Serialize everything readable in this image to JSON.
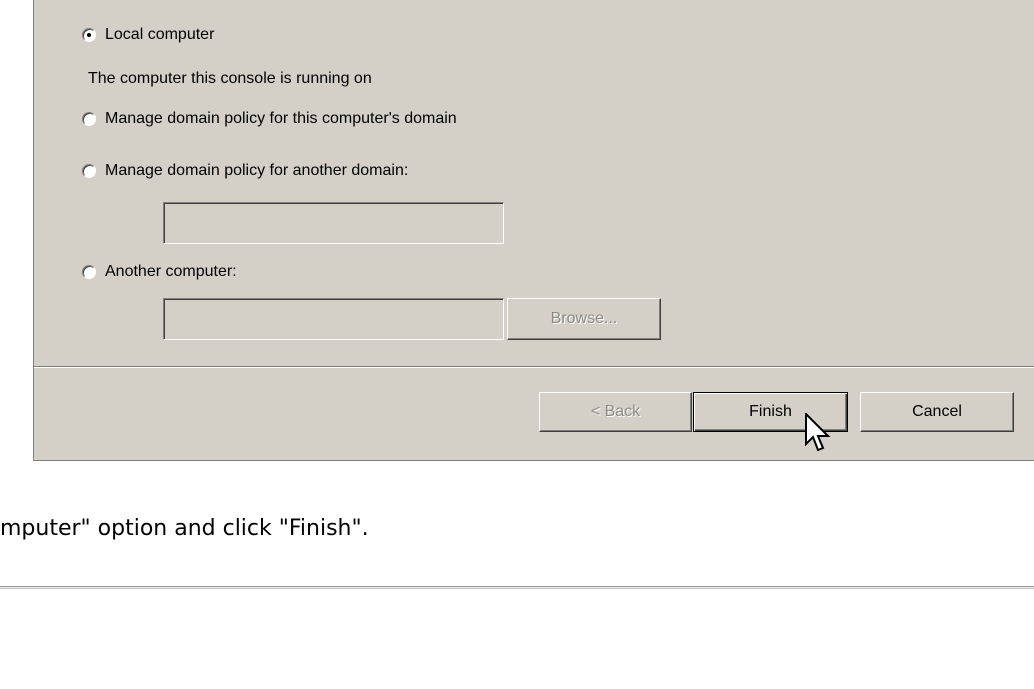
{
  "options": {
    "local": "Local computer",
    "local_hint": "The computer this console is running on",
    "this_domain": "Manage domain policy for this computer's domain",
    "other_domain": "Manage domain policy for another domain:",
    "other_computer": "Another computer:"
  },
  "fields": {
    "domain_value": "",
    "computer_value": ""
  },
  "buttons": {
    "browse": "Browse...",
    "back": "< Back",
    "finish": "Finish",
    "cancel": "Cancel"
  },
  "instruction": "mputer\" option and click \"Finish\"."
}
